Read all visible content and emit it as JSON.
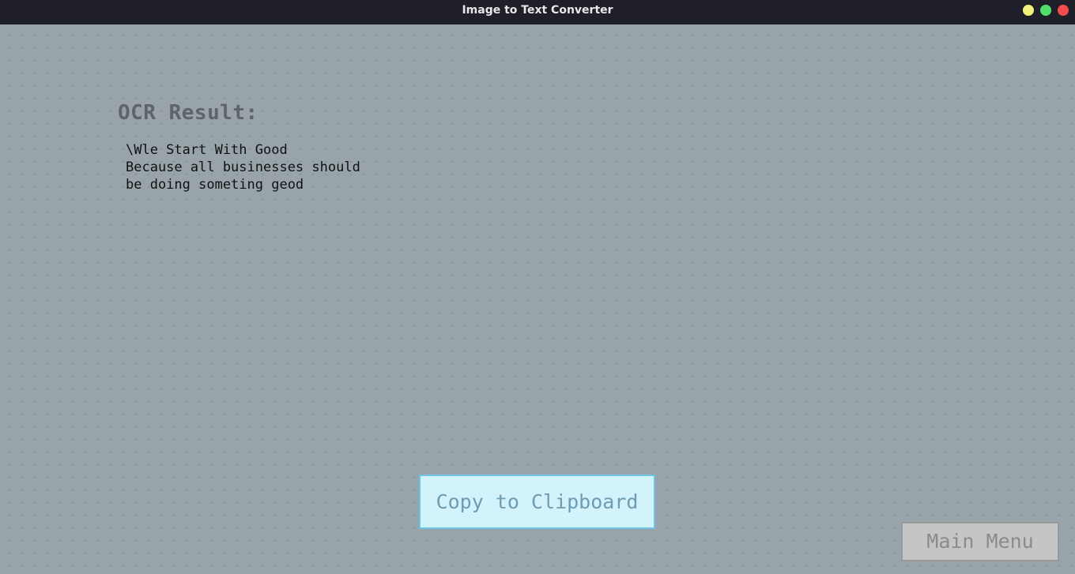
{
  "window": {
    "title": "Image to Text Converter",
    "controls": {
      "minimize_color": "#f1f17c",
      "maximize_color": "#4fe06b",
      "close_color": "#f24b4b"
    }
  },
  "main": {
    "heading": "OCR Result:",
    "result_lines": [
      "\\Wle Start With Good",
      "Because all businesses should",
      "be doing someting geod"
    ]
  },
  "buttons": {
    "copy_label": "Copy to Clipboard",
    "menu_label": "Main Menu"
  },
  "colors": {
    "background": "#98a4a9",
    "titlebar": "#1e1f29",
    "copy_button_bg": "#d2f2fc",
    "copy_button_border": "#6ec4e4",
    "menu_button_bg": "#c5c5c5"
  }
}
